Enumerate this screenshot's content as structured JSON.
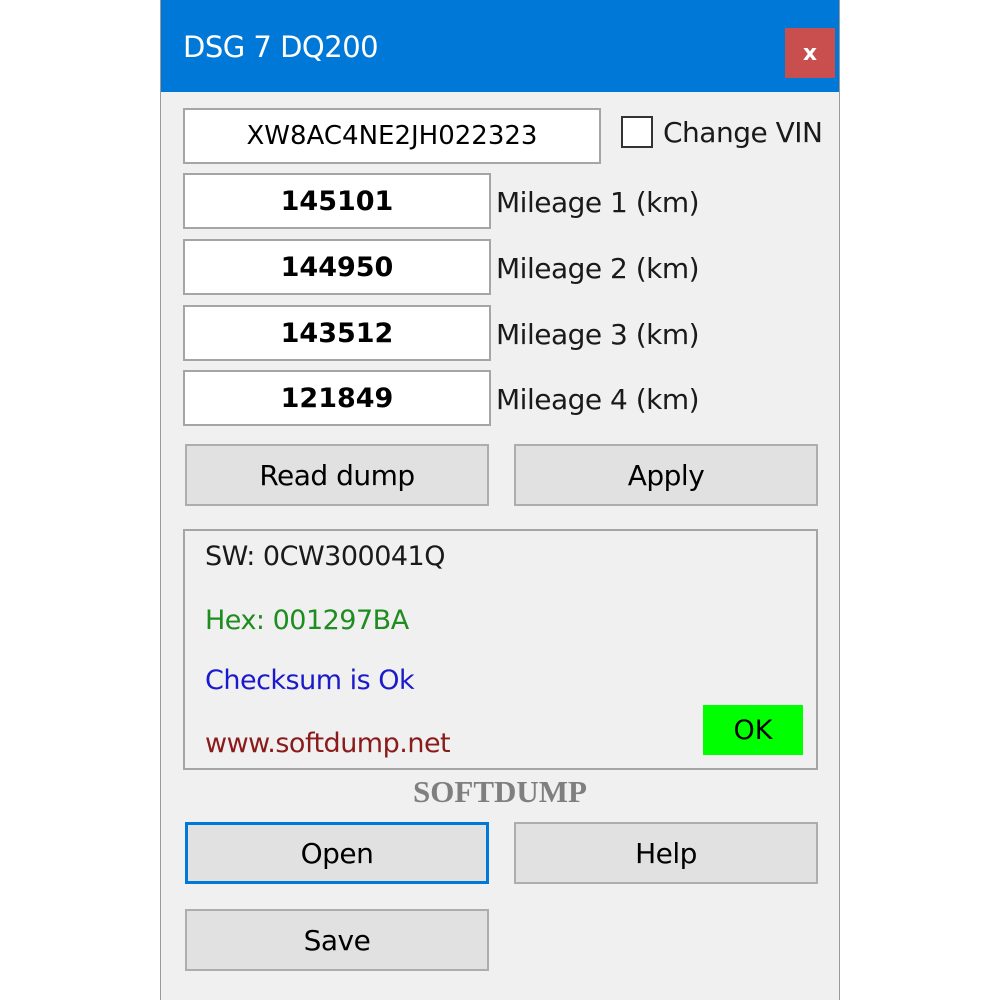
{
  "window": {
    "title": "DSG 7  DQ200",
    "close_label": "x"
  },
  "vin": {
    "value": "XW8AC4NE2JH022323",
    "change_vin_label": "Change VIN",
    "change_vin_checked": false
  },
  "mileage": [
    {
      "value": "145101",
      "label": "Mileage 1 (km)"
    },
    {
      "value": "144950",
      "label": "Mileage 2 (km)"
    },
    {
      "value": "143512",
      "label": "Mileage 3 (km)"
    },
    {
      "value": "121849",
      "label": "Mileage 4 (km)"
    }
  ],
  "buttons": {
    "read_dump": "Read dump",
    "apply": "Apply",
    "open": "Open",
    "help": "Help",
    "save": "Save"
  },
  "info": {
    "sw": "SW: 0CW300041Q",
    "hex": "Hex: 001297BA",
    "checksum": "Checksum is Ok",
    "website": "www.softdump.net",
    "ok": "OK"
  },
  "brand": "SOFTDUMP",
  "colors": {
    "titlebar": "#0078d7",
    "close_button": "#c94f4f",
    "hex_text": "#1e8c1e",
    "checksum_text": "#1a1acc",
    "website_text": "#8b1a1a",
    "ok_badge": "#00ff00"
  }
}
